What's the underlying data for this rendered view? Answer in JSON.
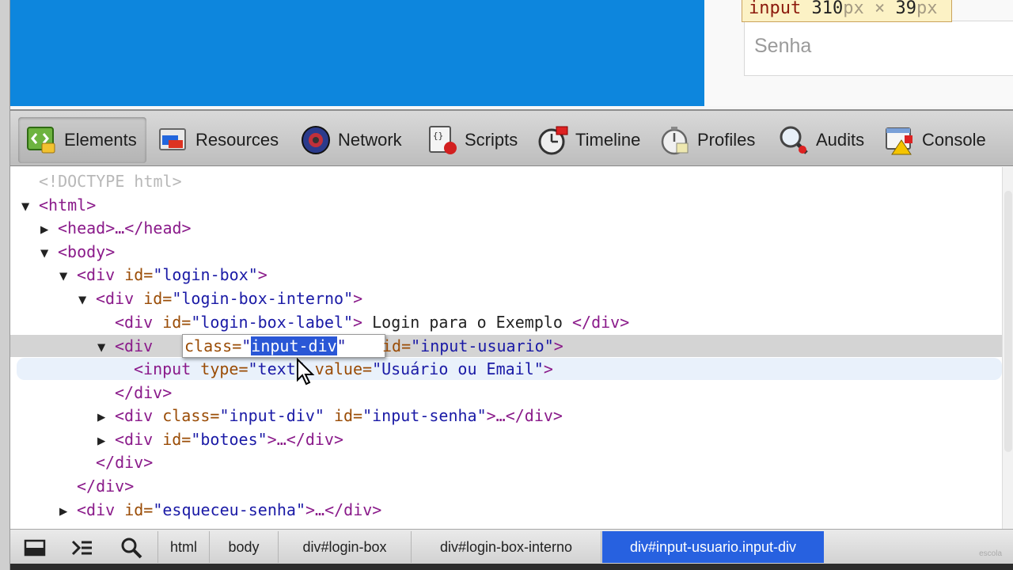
{
  "tooltip": {
    "tag": "input",
    "width": "310",
    "unit1": "px",
    "times": "×",
    "height": "39",
    "unit2": "px"
  },
  "page": {
    "password_placeholder": "Senha"
  },
  "toolbar": {
    "tabs": [
      {
        "label": "Elements",
        "icon": "elements-icon",
        "active": true
      },
      {
        "label": "Resources",
        "icon": "resources-icon"
      },
      {
        "label": "Network",
        "icon": "network-icon"
      },
      {
        "label": "Scripts",
        "icon": "scripts-icon"
      },
      {
        "label": "Timeline",
        "icon": "timeline-icon"
      },
      {
        "label": "Profiles",
        "icon": "profiles-icon"
      },
      {
        "label": "Audits",
        "icon": "audits-icon"
      },
      {
        "label": "Console",
        "icon": "console-icon"
      }
    ]
  },
  "tree": {
    "doctype": "<!DOCTYPE html>",
    "html_open": "<html>",
    "head": "<head>…</head>",
    "body_open": "<body>",
    "login_box_tag": "<div ",
    "login_box_attr": "id=",
    "login_box_val": "\"login-box\"",
    "login_box_end": ">",
    "interno_tag": "<div ",
    "interno_attr": "id=",
    "interno_val": "\"login-box-interno\"",
    "interno_end": ">",
    "label_tag": "<div ",
    "label_attr": "id=",
    "label_val": "\"login-box-label\"",
    "label_end": ">",
    "label_text": " Login para o Exemplo ",
    "label_close": "</div>",
    "usuario_tag": "<div",
    "usuario_class_attr": "class=",
    "usuario_class_q1": "\"",
    "usuario_class_val": "input-div",
    "usuario_class_q2": "\"",
    "usuario_id_attr": "id=",
    "usuario_id_val": "\"input-usuario\"",
    "usuario_end": ">",
    "input_tag": "<input ",
    "input_type_attr": "type=",
    "input_type_val": "\"text\"",
    "input_value_attr": " value=",
    "input_value_val": "\"Usuário ou Email\"",
    "input_end": ">",
    "div_close": "</div>",
    "senha_tag": "<div ",
    "senha_class_attr": "class=",
    "senha_class_val": "\"input-div\"",
    "senha_id_attr": " id=",
    "senha_id_val": "\"input-senha\"",
    "senha_end": ">…</div>",
    "botoes_tag": "<div ",
    "botoes_attr": "id=",
    "botoes_val": "\"botoes\"",
    "botoes_end": ">…</div>",
    "div_close2": "</div>",
    "div_close3": "</div>",
    "esqueceu_tag": "<div ",
    "esqueceu_attr": "id=",
    "esqueceu_val": "\"esqueceu-senha\"",
    "esqueceu_end": ">…</div>"
  },
  "breadcrumbs": [
    "html",
    "body",
    "div#login-box",
    "div#login-box-interno",
    "div#input-usuario.input-div"
  ],
  "watermark": "escola"
}
